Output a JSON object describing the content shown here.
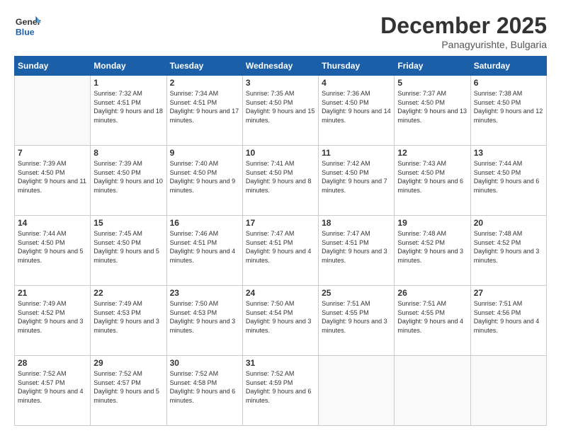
{
  "logo": {
    "line1": "General",
    "line2": "Blue"
  },
  "header": {
    "month": "December 2025",
    "location": "Panagyurishte, Bulgaria"
  },
  "weekdays": [
    "Sunday",
    "Monday",
    "Tuesday",
    "Wednesday",
    "Thursday",
    "Friday",
    "Saturday"
  ],
  "weeks": [
    [
      {
        "day": "",
        "sunrise": "",
        "sunset": "",
        "daylight": ""
      },
      {
        "day": "1",
        "sunrise": "Sunrise: 7:32 AM",
        "sunset": "Sunset: 4:51 PM",
        "daylight": "Daylight: 9 hours and 18 minutes."
      },
      {
        "day": "2",
        "sunrise": "Sunrise: 7:34 AM",
        "sunset": "Sunset: 4:51 PM",
        "daylight": "Daylight: 9 hours and 17 minutes."
      },
      {
        "day": "3",
        "sunrise": "Sunrise: 7:35 AM",
        "sunset": "Sunset: 4:50 PM",
        "daylight": "Daylight: 9 hours and 15 minutes."
      },
      {
        "day": "4",
        "sunrise": "Sunrise: 7:36 AM",
        "sunset": "Sunset: 4:50 PM",
        "daylight": "Daylight: 9 hours and 14 minutes."
      },
      {
        "day": "5",
        "sunrise": "Sunrise: 7:37 AM",
        "sunset": "Sunset: 4:50 PM",
        "daylight": "Daylight: 9 hours and 13 minutes."
      },
      {
        "day": "6",
        "sunrise": "Sunrise: 7:38 AM",
        "sunset": "Sunset: 4:50 PM",
        "daylight": "Daylight: 9 hours and 12 minutes."
      }
    ],
    [
      {
        "day": "7",
        "sunrise": "Sunrise: 7:39 AM",
        "sunset": "Sunset: 4:50 PM",
        "daylight": "Daylight: 9 hours and 11 minutes."
      },
      {
        "day": "8",
        "sunrise": "Sunrise: 7:39 AM",
        "sunset": "Sunset: 4:50 PM",
        "daylight": "Daylight: 9 hours and 10 minutes."
      },
      {
        "day": "9",
        "sunrise": "Sunrise: 7:40 AM",
        "sunset": "Sunset: 4:50 PM",
        "daylight": "Daylight: 9 hours and 9 minutes."
      },
      {
        "day": "10",
        "sunrise": "Sunrise: 7:41 AM",
        "sunset": "Sunset: 4:50 PM",
        "daylight": "Daylight: 9 hours and 8 minutes."
      },
      {
        "day": "11",
        "sunrise": "Sunrise: 7:42 AM",
        "sunset": "Sunset: 4:50 PM",
        "daylight": "Daylight: 9 hours and 7 minutes."
      },
      {
        "day": "12",
        "sunrise": "Sunrise: 7:43 AM",
        "sunset": "Sunset: 4:50 PM",
        "daylight": "Daylight: 9 hours and 6 minutes."
      },
      {
        "day": "13",
        "sunrise": "Sunrise: 7:44 AM",
        "sunset": "Sunset: 4:50 PM",
        "daylight": "Daylight: 9 hours and 6 minutes."
      }
    ],
    [
      {
        "day": "14",
        "sunrise": "Sunrise: 7:44 AM",
        "sunset": "Sunset: 4:50 PM",
        "daylight": "Daylight: 9 hours and 5 minutes."
      },
      {
        "day": "15",
        "sunrise": "Sunrise: 7:45 AM",
        "sunset": "Sunset: 4:50 PM",
        "daylight": "Daylight: 9 hours and 5 minutes."
      },
      {
        "day": "16",
        "sunrise": "Sunrise: 7:46 AM",
        "sunset": "Sunset: 4:51 PM",
        "daylight": "Daylight: 9 hours and 4 minutes."
      },
      {
        "day": "17",
        "sunrise": "Sunrise: 7:47 AM",
        "sunset": "Sunset: 4:51 PM",
        "daylight": "Daylight: 9 hours and 4 minutes."
      },
      {
        "day": "18",
        "sunrise": "Sunrise: 7:47 AM",
        "sunset": "Sunset: 4:51 PM",
        "daylight": "Daylight: 9 hours and 3 minutes."
      },
      {
        "day": "19",
        "sunrise": "Sunrise: 7:48 AM",
        "sunset": "Sunset: 4:52 PM",
        "daylight": "Daylight: 9 hours and 3 minutes."
      },
      {
        "day": "20",
        "sunrise": "Sunrise: 7:48 AM",
        "sunset": "Sunset: 4:52 PM",
        "daylight": "Daylight: 9 hours and 3 minutes."
      }
    ],
    [
      {
        "day": "21",
        "sunrise": "Sunrise: 7:49 AM",
        "sunset": "Sunset: 4:52 PM",
        "daylight": "Daylight: 9 hours and 3 minutes."
      },
      {
        "day": "22",
        "sunrise": "Sunrise: 7:49 AM",
        "sunset": "Sunset: 4:53 PM",
        "daylight": "Daylight: 9 hours and 3 minutes."
      },
      {
        "day": "23",
        "sunrise": "Sunrise: 7:50 AM",
        "sunset": "Sunset: 4:53 PM",
        "daylight": "Daylight: 9 hours and 3 minutes."
      },
      {
        "day": "24",
        "sunrise": "Sunrise: 7:50 AM",
        "sunset": "Sunset: 4:54 PM",
        "daylight": "Daylight: 9 hours and 3 minutes."
      },
      {
        "day": "25",
        "sunrise": "Sunrise: 7:51 AM",
        "sunset": "Sunset: 4:55 PM",
        "daylight": "Daylight: 9 hours and 3 minutes."
      },
      {
        "day": "26",
        "sunrise": "Sunrise: 7:51 AM",
        "sunset": "Sunset: 4:55 PM",
        "daylight": "Daylight: 9 hours and 4 minutes."
      },
      {
        "day": "27",
        "sunrise": "Sunrise: 7:51 AM",
        "sunset": "Sunset: 4:56 PM",
        "daylight": "Daylight: 9 hours and 4 minutes."
      }
    ],
    [
      {
        "day": "28",
        "sunrise": "Sunrise: 7:52 AM",
        "sunset": "Sunset: 4:57 PM",
        "daylight": "Daylight: 9 hours and 4 minutes."
      },
      {
        "day": "29",
        "sunrise": "Sunrise: 7:52 AM",
        "sunset": "Sunset: 4:57 PM",
        "daylight": "Daylight: 9 hours and 5 minutes."
      },
      {
        "day": "30",
        "sunrise": "Sunrise: 7:52 AM",
        "sunset": "Sunset: 4:58 PM",
        "daylight": "Daylight: 9 hours and 6 minutes."
      },
      {
        "day": "31",
        "sunrise": "Sunrise: 7:52 AM",
        "sunset": "Sunset: 4:59 PM",
        "daylight": "Daylight: 9 hours and 6 minutes."
      },
      {
        "day": "",
        "sunrise": "",
        "sunset": "",
        "daylight": ""
      },
      {
        "day": "",
        "sunrise": "",
        "sunset": "",
        "daylight": ""
      },
      {
        "day": "",
        "sunrise": "",
        "sunset": "",
        "daylight": ""
      }
    ]
  ]
}
